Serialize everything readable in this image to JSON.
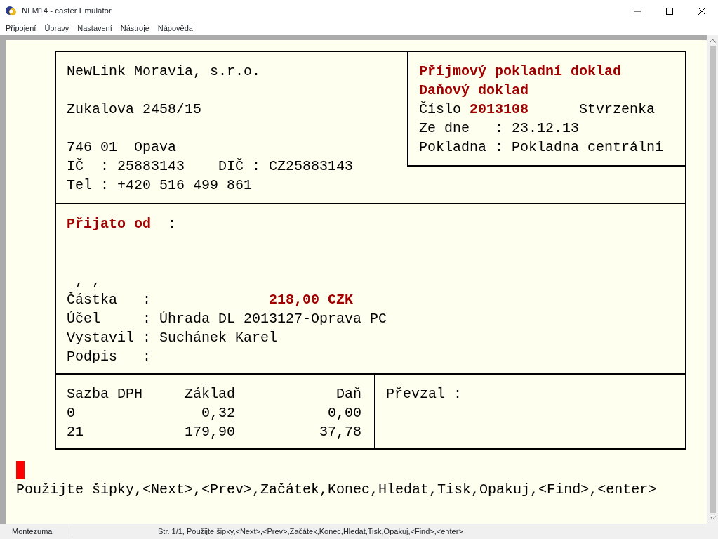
{
  "window": {
    "title": "NLM14 - caster Emulator"
  },
  "menu": [
    "Připojení",
    "Úpravy",
    "Nastavení",
    "Nástroje",
    "Nápověda"
  ],
  "document": {
    "company_lines": [
      {
        "kind": "text",
        "text": "NewLink Moravia, s.r.o."
      },
      {
        "kind": "blank"
      },
      {
        "kind": "text",
        "text": "Zukalova 2458/15"
      },
      {
        "kind": "blank"
      },
      {
        "kind": "text",
        "text": "746 01  Opava"
      },
      {
        "kind": "text",
        "text": "IČ  : 25883143    DIČ : CZ25883143"
      },
      {
        "kind": "text",
        "text": "Tel : +420 516 499 861"
      }
    ],
    "header_lines": [
      {
        "kind": "heading",
        "text": "Příjmový pokladní doklad"
      },
      {
        "kind": "heading",
        "text": "Daňový doklad"
      },
      {
        "kind": "text",
        "text": "Číslo **2013108**      Stvrzenka"
      },
      {
        "kind": "text",
        "text": "Ze dne   : 23.12.13"
      },
      {
        "kind": "text",
        "text": "Pokladna : Pokladna centrální"
      }
    ],
    "body_lines": [
      {
        "kind": "text",
        "text": "**Přijato od**  :"
      },
      {
        "kind": "blank"
      },
      {
        "kind": "blank"
      },
      {
        "kind": "text",
        "text": " , ,"
      },
      {
        "kind": "text",
        "text": "Částka   :              **218,00 CZK**"
      },
      {
        "kind": "text",
        "text": "Účel     : Úhrada DL 2013127-Oprava PC"
      },
      {
        "kind": "text",
        "text": "Vystavil : Suchánek Karel"
      },
      {
        "kind": "text",
        "text": "Podpis   :"
      }
    ],
    "tax_table": {
      "columns": [
        "Sazba DPH",
        "Základ",
        "Daň"
      ],
      "rows": [
        [
          "0",
          "0,32",
          "0,00"
        ],
        [
          "21",
          "179,90",
          "37,78"
        ]
      ]
    },
    "received_label": "Převzal :"
  },
  "prompt": "Použijte šipky,<Next>,<Prev>,Začátek,Konec,Hledat,Tisk,Opakuj,<Find>,<enter>",
  "status_bar": [
    "Montezuma",
    "Str. 1/1, Použijte šipky,<Next>,<Prev>,Začátek,Konec,Hledat,Tisk,Opakuj,<Find>,<enter>"
  ]
}
